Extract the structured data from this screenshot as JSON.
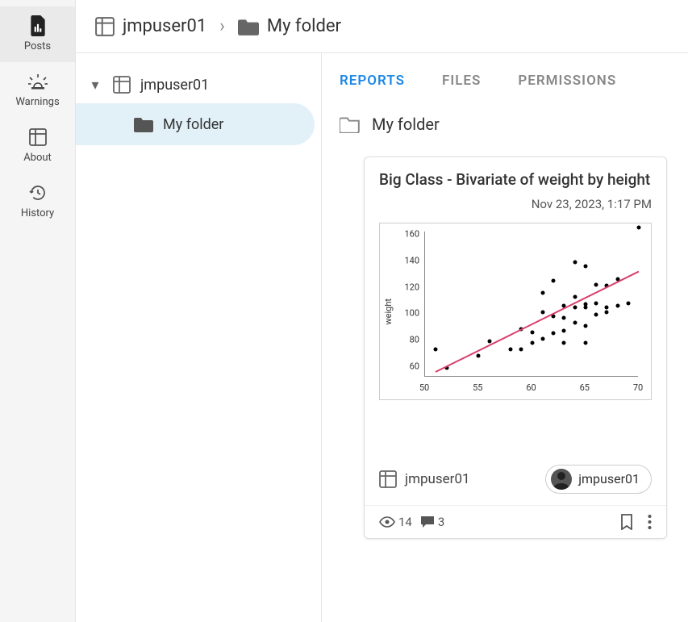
{
  "nav": {
    "items": [
      {
        "label": "Posts"
      },
      {
        "label": "Warnings"
      },
      {
        "label": "About"
      },
      {
        "label": "History"
      }
    ]
  },
  "breadcrumbs": {
    "root": "jmpuser01",
    "leaf": "My folder"
  },
  "tree": {
    "root": "jmpuser01",
    "child": "My folder"
  },
  "tabs": {
    "reports": "REPORTS",
    "files": "FILES",
    "permissions": "PERMISSIONS"
  },
  "folder_heading": "My folder",
  "card": {
    "title": "Big Class - Bivariate of weight by height",
    "date": "Nov 23, 2023, 1:17 PM",
    "owner_grid": "jmpuser01",
    "chip_user": "jmpuser01",
    "views": "14",
    "comments": "3"
  },
  "chart_data": {
    "type": "scatter",
    "title": "",
    "xlabel": "",
    "ylabel": "weight",
    "xlim": [
      50,
      70
    ],
    "ylim": [
      60,
      170
    ],
    "x_ticks": [
      50,
      55,
      60,
      65,
      70
    ],
    "y_ticks": [
      60,
      80,
      100,
      120,
      140,
      160
    ],
    "trend_line": {
      "x": [
        51,
        70
      ],
      "y": [
        62,
        138
      ]
    },
    "points": [
      {
        "x": 51,
        "y": 80
      },
      {
        "x": 52,
        "y": 66
      },
      {
        "x": 55,
        "y": 75
      },
      {
        "x": 56,
        "y": 86
      },
      {
        "x": 58,
        "y": 80
      },
      {
        "x": 59,
        "y": 95
      },
      {
        "x": 59,
        "y": 80
      },
      {
        "x": 60,
        "y": 85
      },
      {
        "x": 60,
        "y": 93
      },
      {
        "x": 61,
        "y": 88
      },
      {
        "x": 61,
        "y": 108
      },
      {
        "x": 61,
        "y": 123
      },
      {
        "x": 62,
        "y": 92
      },
      {
        "x": 62,
        "y": 105
      },
      {
        "x": 62,
        "y": 132
      },
      {
        "x": 63,
        "y": 85
      },
      {
        "x": 63,
        "y": 94
      },
      {
        "x": 63,
        "y": 104
      },
      {
        "x": 63,
        "y": 113
      },
      {
        "x": 64,
        "y": 100
      },
      {
        "x": 64,
        "y": 112
      },
      {
        "x": 64,
        "y": 120
      },
      {
        "x": 64,
        "y": 146
      },
      {
        "x": 65,
        "y": 85
      },
      {
        "x": 65,
        "y": 98
      },
      {
        "x": 65,
        "y": 112
      },
      {
        "x": 65,
        "y": 114
      },
      {
        "x": 65,
        "y": 143
      },
      {
        "x": 66,
        "y": 106
      },
      {
        "x": 66,
        "y": 115
      },
      {
        "x": 66,
        "y": 129
      },
      {
        "x": 67,
        "y": 108
      },
      {
        "x": 67,
        "y": 112
      },
      {
        "x": 67,
        "y": 128
      },
      {
        "x": 68,
        "y": 113
      },
      {
        "x": 68,
        "y": 133
      },
      {
        "x": 69,
        "y": 115
      },
      {
        "x": 70,
        "y": 172
      }
    ]
  }
}
